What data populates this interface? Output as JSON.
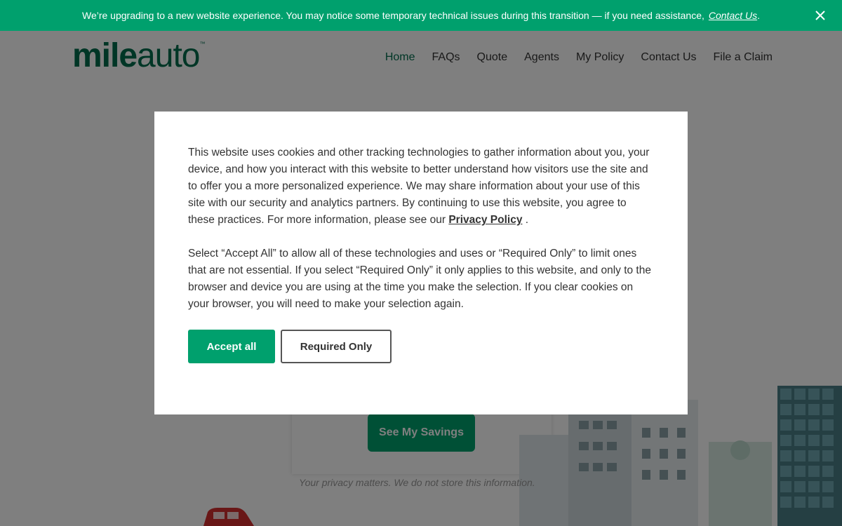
{
  "banner": {
    "message": "We’re upgrading to a new website experience. You may notice some temporary technical issues during this transition — if you need assistance,",
    "link": "Contact Us",
    "period": "."
  },
  "logo": {
    "part1": "mile",
    "part2": "auto",
    "tm": "™"
  },
  "nav": {
    "items": [
      {
        "label": "Home"
      },
      {
        "label": "FAQs"
      },
      {
        "label": "Quote"
      },
      {
        "label": "Agents"
      },
      {
        "label": "My Policy"
      },
      {
        "label": "Contact Us"
      },
      {
        "label": "File a Claim"
      }
    ],
    "active_color": "#006d4d"
  },
  "hero": {
    "cta": "See My Savings",
    "privacy_note": "Your privacy matters. We do not store this information."
  },
  "modal": {
    "p1_text": "This website uses cookies and other tracking technologies to gather information about you, your device, and how you interact with this website to better understand how visitors use the site and to offer you a more personalized experience. We may share information about your use of this site with our security and analytics partners. By continuing to use this website, you agree to these practices. For more information, please see our",
    "p1_link": "Privacy Policy",
    "p1_end": ".",
    "p2_text": "Select “Accept All” to allow all of these technologies and uses or “Required Only” to limit ones that are not essential. If you select “Required Only” it only applies to this website, and only to the browser and device you are using at the time you make the selection. If you clear cookies on your browser, you will need to make your selection again.",
    "accept_label": "Accept all",
    "required_label": "Required Only"
  },
  "colors": {
    "brand": "#00a06d",
    "brand_dark": "#006d4d"
  },
  "icons": {
    "close": "close-icon"
  }
}
